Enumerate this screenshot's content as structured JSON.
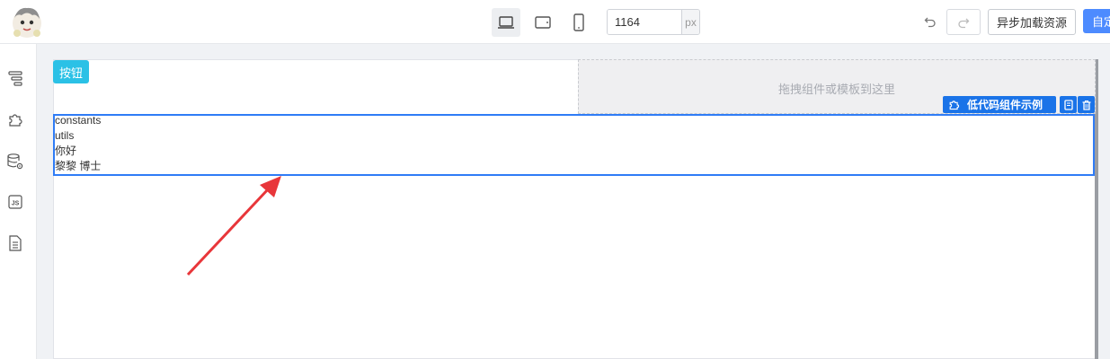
{
  "toolbar": {
    "width_value": "1164",
    "width_unit": "px",
    "async_load_label": "异步加载资源",
    "primary_label": "自定义"
  },
  "canvas": {
    "button_label": "按钮",
    "drop_placeholder": "拖拽组件或模板到这里",
    "selected_component_tag": "低代码组件示例",
    "selected_lines": [
      "constants",
      "utils",
      "你好",
      "黎黎 博士"
    ]
  },
  "colors": {
    "selection": "#2f7cf6",
    "button_chip": "#2bc1e6",
    "primary": "#4d8bff",
    "annotation_arrow": "#e8363a"
  }
}
